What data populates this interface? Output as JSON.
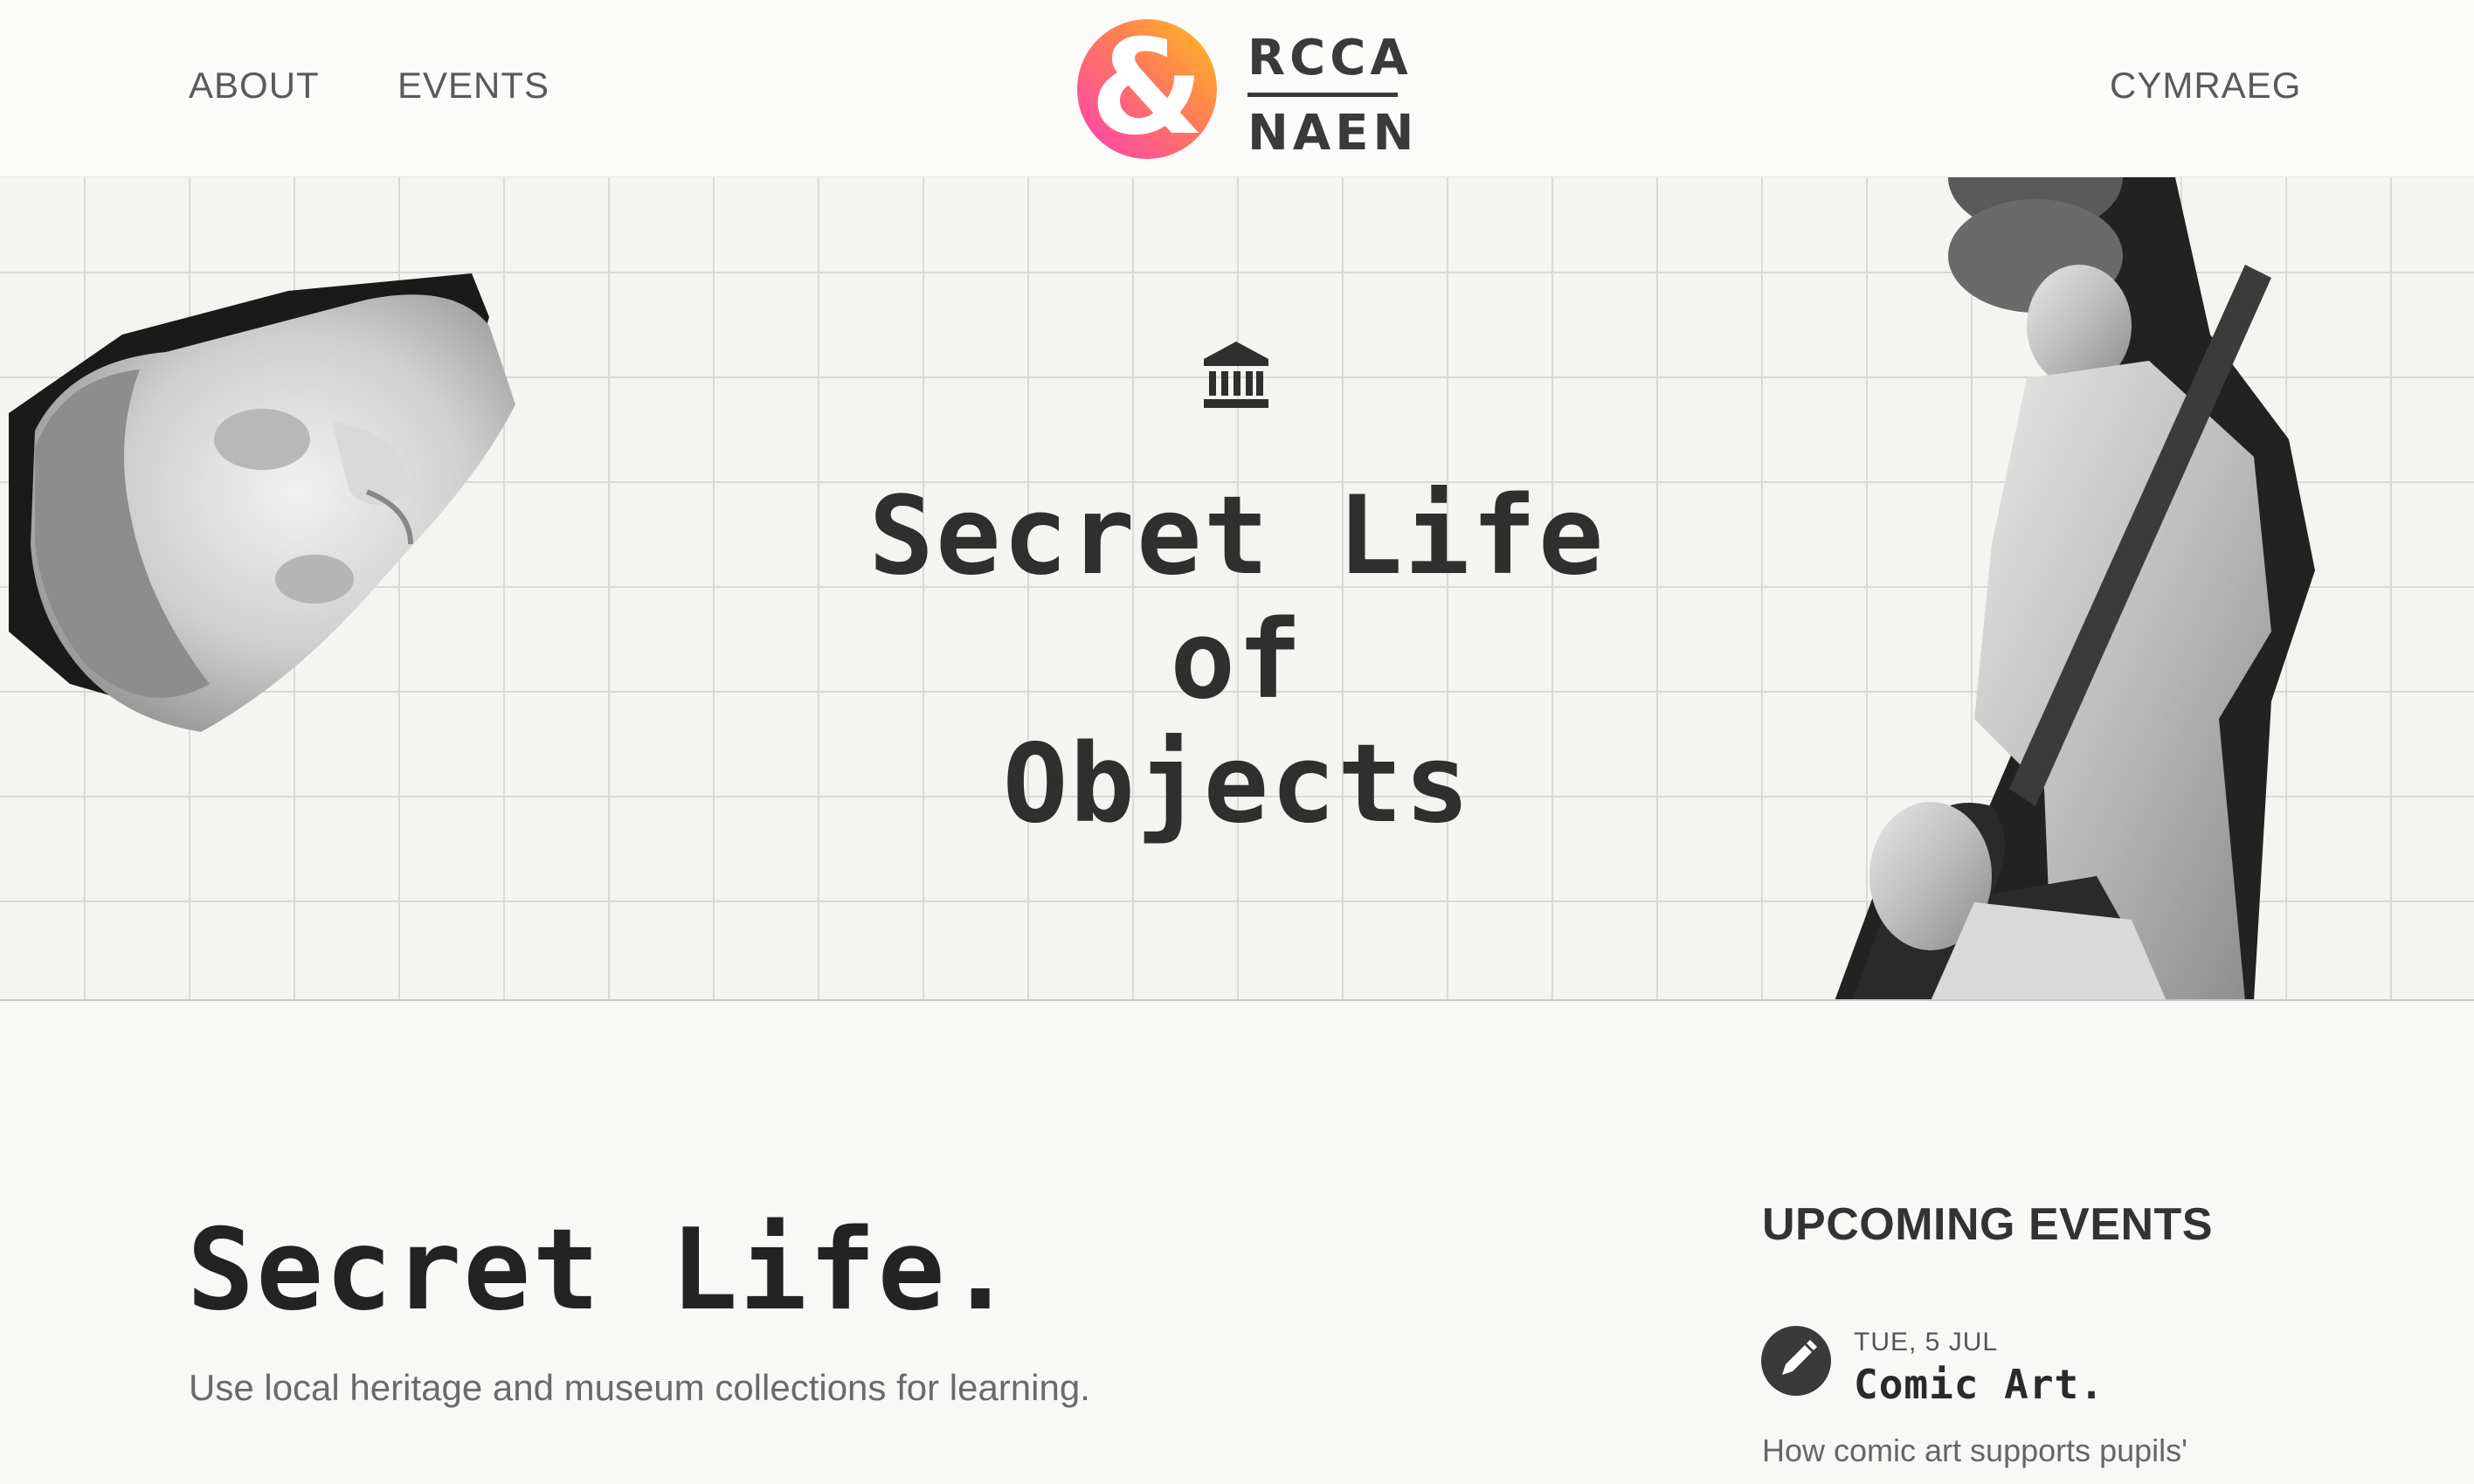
{
  "nav": {
    "about": "ABOUT",
    "events": "EVENTS",
    "language": "CYMRAEG"
  },
  "logo": {
    "top": "RCCA",
    "bottom": "NAEN",
    "mark_symbol": "&"
  },
  "hero": {
    "icon": "museum-icon",
    "title_lines": [
      "Secret Life",
      "of",
      "Objects"
    ]
  },
  "main": {
    "title": "Secret Life.",
    "subtitle": "Use local heritage and museum collections for learning."
  },
  "events": {
    "heading": "UPCOMING EVENTS",
    "items": [
      {
        "icon": "pencil-icon",
        "date": "TUE, 5 JUL",
        "title": "Comic Art.",
        "description": "How comic art supports pupils'"
      }
    ]
  },
  "colors": {
    "logo_gradient": [
      "#ff4fb0",
      "#ffb21a"
    ],
    "text_dark": "#2f2f2f",
    "grid_bg": "#f4f4f0"
  }
}
